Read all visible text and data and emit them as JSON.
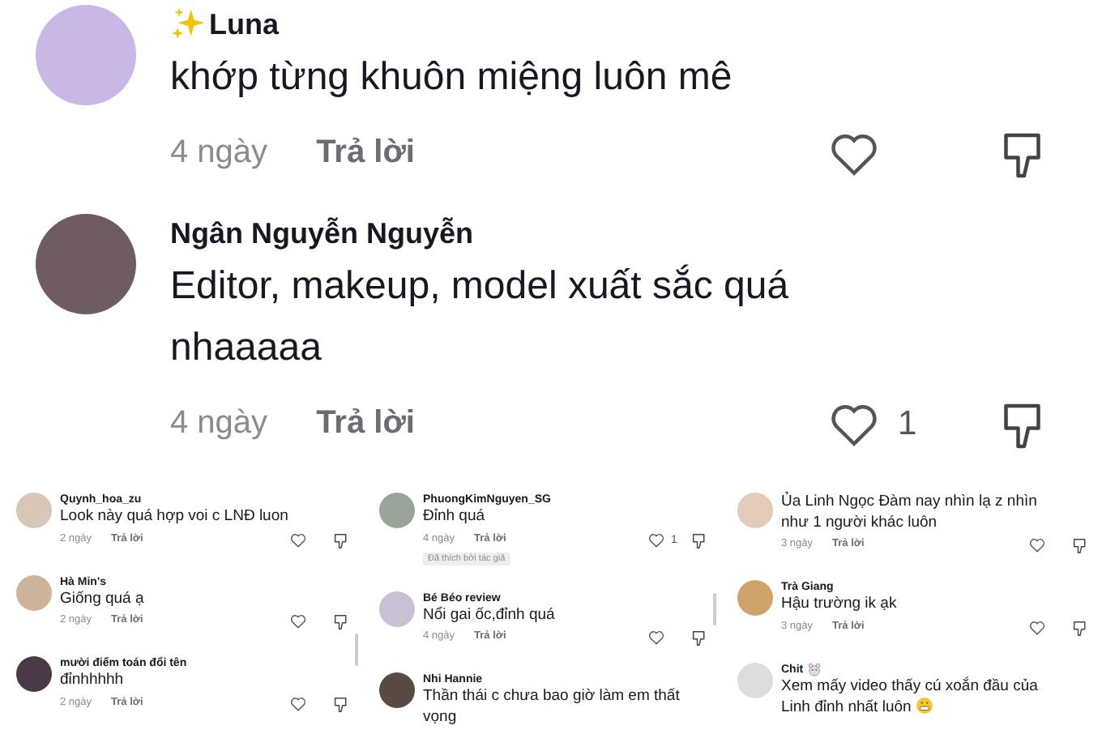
{
  "featured_comments": [
    {
      "kind": "sparkled",
      "name": "Luna",
      "text": "khớp từng khuôn miệng luôn mê",
      "time": "4 ngày",
      "reply": "Trả lời"
    },
    {
      "name": "Ngân Nguyễn Nguyễn",
      "text": "Editor, makeup, model xuất sắc quá nhaaaaa",
      "time": "4 ngày",
      "reply": "Trả lời",
      "likes": "1"
    }
  ],
  "panels": [
    {
      "comments": [
        {
          "name": "Quynh_hoa_zu",
          "text": "Look này quá hợp voi c LNĐ luon",
          "time": "2 ngày",
          "reply": "Trả lời"
        },
        {
          "name": "Hà Min's",
          "text": "Giống quá ạ",
          "time": "2 ngày",
          "reply": "Trả lời"
        },
        {
          "name": "mười điểm toán đổi tên",
          "text": "đỉnhhhhh",
          "time": "2 ngày",
          "reply": "Trả lời"
        }
      ]
    },
    {
      "comments": [
        {
          "name": "PhuongKimNguyen_SG",
          "text": "Đỉnh quá",
          "time": "4 ngày",
          "reply": "Trả lời",
          "likes": "1",
          "author_badge": "Đã thích bởi tác giả"
        },
        {
          "name": "Bé Béo review",
          "text": "Nổi gai ốc,đỉnh quá",
          "time": "4 ngày",
          "reply": "Trả lời"
        },
        {
          "name": "Nhi Hannie",
          "text": "Thần thái c chưa bao giờ làm em thất vọng"
        }
      ]
    },
    {
      "comments": [
        {
          "text": "Ủa Linh Ngọc Đàm nay nhìn lạ z nhìn như 1 người khác luôn",
          "time": "3 ngày",
          "reply": "Trả lời"
        },
        {
          "name": "Trà Giang",
          "text": "Hậu trường ik ạk",
          "time": "3 ngày",
          "reply": "Trả lời"
        },
        {
          "kind": "emoji",
          "name": "Chit",
          "text": "Xem mấy video thấy cú xoắn đầu của Linh đỉnh nhất luôn"
        }
      ]
    }
  ]
}
